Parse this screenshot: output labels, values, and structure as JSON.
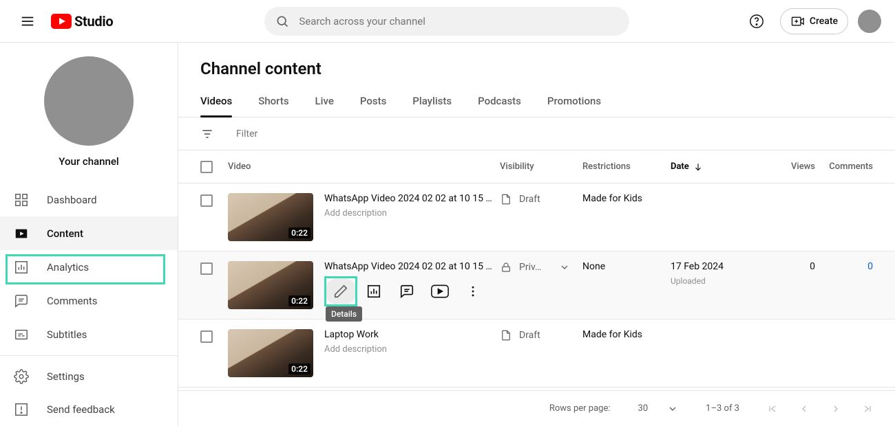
{
  "header": {
    "logo_text": "Studio",
    "search_placeholder": "Search across your channel",
    "create_label": "Create"
  },
  "sidebar": {
    "channel_label": "Your channel",
    "items": [
      {
        "label": "Dashboard"
      },
      {
        "label": "Content"
      },
      {
        "label": "Analytics"
      },
      {
        "label": "Comments"
      },
      {
        "label": "Subtitles"
      }
    ],
    "settings_label": "Settings",
    "feedback_label": "Send feedback"
  },
  "page": {
    "title": "Channel content",
    "tabs": [
      "Videos",
      "Shorts",
      "Live",
      "Posts",
      "Playlists",
      "Podcasts",
      "Promotions"
    ],
    "active_tab": "Videos",
    "filter_placeholder": "Filter",
    "columns": {
      "video": "Video",
      "visibility": "Visibility",
      "restrictions": "Restrictions",
      "date": "Date",
      "views": "Views",
      "comments": "Comments"
    },
    "hover_tooltip": "Details"
  },
  "rows": [
    {
      "duration": "0:22",
      "title": "WhatsApp Video 2024 02 02 at 10 15 …",
      "subtitle": "Add description",
      "visibility": "Draft",
      "visibility_kind": "draft",
      "restrictions": "Made for Kids",
      "date": "",
      "date_sub": "",
      "views": "",
      "comments": ""
    },
    {
      "duration": "0:22",
      "title": "WhatsApp Video 2024 02 02 at 10 15 …",
      "subtitle": "",
      "visibility": "Priv…",
      "visibility_kind": "private",
      "restrictions": "None",
      "date": "17 Feb 2024",
      "date_sub": "Uploaded",
      "views": "0",
      "comments": "0",
      "hovered": true
    },
    {
      "duration": "0:22",
      "title": "Laptop Work",
      "subtitle": "Add description",
      "visibility": "Draft",
      "visibility_kind": "draft",
      "restrictions": "Made for Kids",
      "date": "",
      "date_sub": "",
      "views": "",
      "comments": ""
    }
  ],
  "footer": {
    "rows_label": "Rows per page:",
    "rows_value": "30",
    "range": "1–3 of 3"
  }
}
